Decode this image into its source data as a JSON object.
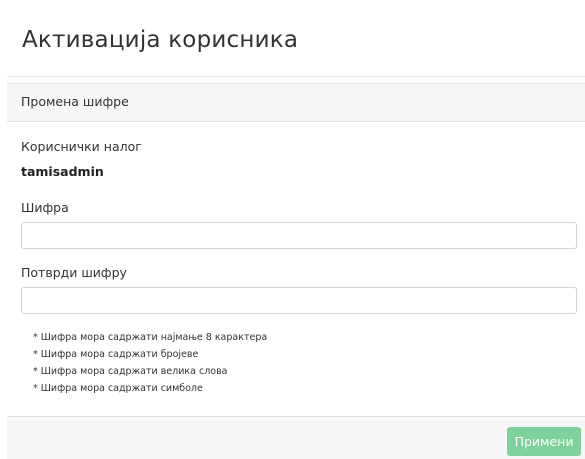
{
  "page": {
    "title": "Активација корисника"
  },
  "card": {
    "header_label": "Промена шифре",
    "account_label": "Кориснички налог",
    "account_value": "tamisadmin",
    "password_label": "Шифра",
    "password_value": "",
    "confirm_label": "Потврди шифру",
    "confirm_value": "",
    "rules": [
      "* Шифра мора садржати најмање 8 карактера",
      "* Шифра мора садржати бројеве",
      "* Шифра мора садржати велика слова",
      "* Шифра мора садржати симболе"
    ],
    "apply_label": "Примени"
  },
  "colors": {
    "apply_button": "#7fd19b",
    "header_background": "#f7f7f7"
  }
}
